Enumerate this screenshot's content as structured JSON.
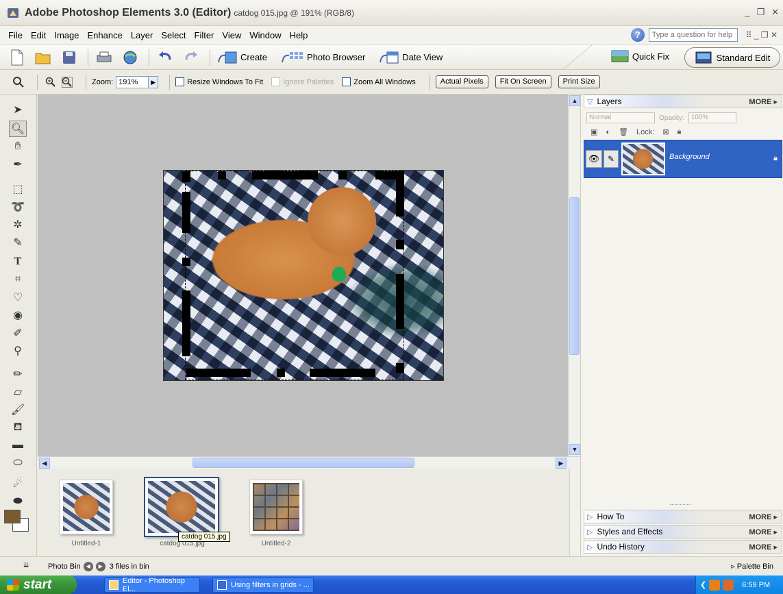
{
  "window": {
    "title_bold": "Adobe Photoshop Elements 3.0 (Editor)",
    "title_doc": "catdog 015.jpg @ 191% (RGB/8)",
    "controls": [
      "_",
      "❐",
      "✕"
    ]
  },
  "menu": {
    "items": [
      "File",
      "Edit",
      "Image",
      "Enhance",
      "Layer",
      "Select",
      "Filter",
      "View",
      "Window",
      "Help"
    ],
    "help_placeholder": "Type a question for help",
    "help_icon": "?"
  },
  "shortcuts": {
    "create": "Create",
    "photo_browser": "Photo Browser",
    "date_view": "Date View",
    "quick_fix": "Quick Fix",
    "standard_edit": "Standard Edit"
  },
  "options": {
    "zoom_label": "Zoom:",
    "zoom_value": "191%",
    "resize_windows": "Resize Windows To Fit",
    "ignore_palettes": "Ignore Palettes",
    "zoom_all": "Zoom All Windows",
    "actual_pixels": "Actual Pixels",
    "fit_on_screen": "Fit On Screen",
    "print_size": "Print Size"
  },
  "photo_bin": {
    "items": [
      {
        "caption": "Untitled-1"
      },
      {
        "caption": "catdog 015.jpg"
      },
      {
        "caption": "Untitled-2"
      }
    ],
    "tooltip": "catdog 015.jpg"
  },
  "palette": {
    "layers": {
      "title": "Layers",
      "more": "MORE",
      "blend_mode": "Normal",
      "opacity_label": "Opacity:",
      "opacity_value": "100%",
      "lock_label": "Lock:",
      "layer_name": "Background"
    },
    "how_to": {
      "title": "How To",
      "more": "MORE"
    },
    "styles": {
      "title": "Styles and Effects",
      "more": "MORE"
    },
    "undo": {
      "title": "Undo History",
      "more": "MORE"
    }
  },
  "status": {
    "photo_bin_label": "Photo Bin",
    "files_count": "3 files in bin",
    "palette_bin": "Palette Bin"
  },
  "taskbar": {
    "start": "start",
    "tasks": [
      "Editor - Photoshop El...",
      "Using filters in grids - ..."
    ],
    "clock": "6:59 PM"
  },
  "colors": {
    "foreground": "#7a5a2e",
    "background": "#ffffff",
    "layer_selected": "#2f64c4"
  }
}
